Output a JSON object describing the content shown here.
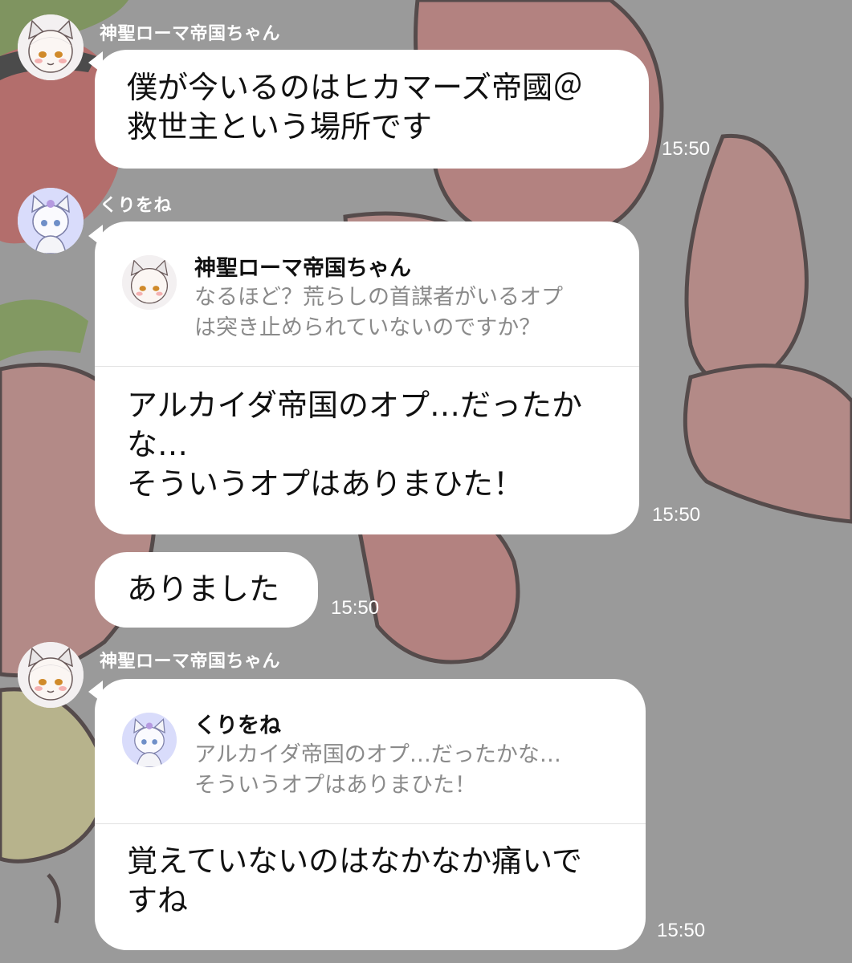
{
  "colors": {
    "bubble": "#ffffff",
    "meta_text": "#ffffff",
    "quote_text": "#8a8a8a",
    "quote_divider": "#e2e2e2"
  },
  "messages": [
    {
      "sender": "神聖ローマ帝国ちゃん",
      "avatar_icon": "anime-cat-girl-avatar-icon",
      "text": "僕が今いるのはヒカマーズ帝國＠\n救世主という場所です",
      "time": "15:50"
    },
    {
      "sender": "くりをね",
      "avatar_icon": "anime-cat-avatar-blue-icon",
      "quote": {
        "sender": "神聖ローマ帝国ちゃん",
        "text": "なるほど？荒らしの首謀者がいるオプ\nは突き止められていないのですか？"
      },
      "text": "アルカイダ帝国のオプ…だったか\nな…\nそういうオプはありまひた！",
      "time": "15:50"
    },
    {
      "text": "ありました",
      "time": "15:50"
    },
    {
      "sender": "神聖ローマ帝国ちゃん",
      "avatar_icon": "anime-cat-girl-avatar-icon",
      "quote": {
        "sender": "くりをね",
        "text": "アルカイダ帝国のオプ…だったかな…\nそういうオプはありまひた！"
      },
      "text": "覚えていないのはなかなか痛いで\nすね",
      "time": "15:50"
    }
  ]
}
